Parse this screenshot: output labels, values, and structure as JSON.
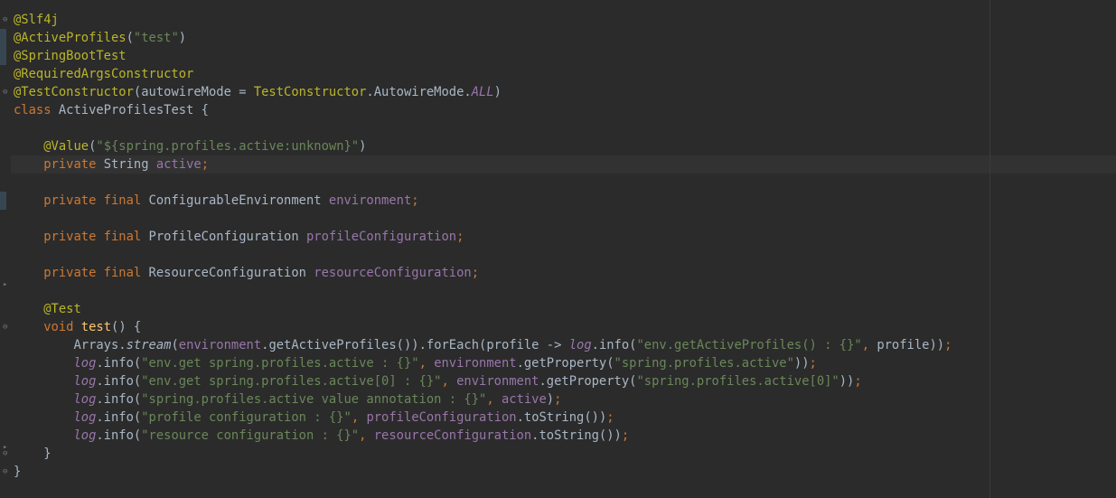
{
  "editor": {
    "lines": [
      [
        {
          "t": "@Slf4j",
          "c": "annotation"
        }
      ],
      [
        {
          "t": "@ActiveProfiles",
          "c": "annotation"
        },
        {
          "t": "(",
          "c": "plain"
        },
        {
          "t": "\"test\"",
          "c": "str"
        },
        {
          "t": ")",
          "c": "plain"
        }
      ],
      [
        {
          "t": "@SpringBootTest",
          "c": "annotation"
        }
      ],
      [
        {
          "t": "@RequiredArgsConstructor",
          "c": "annotation"
        }
      ],
      [
        {
          "t": "@TestConstructor",
          "c": "annotation"
        },
        {
          "t": "(autowireMode = ",
          "c": "plain"
        },
        {
          "t": "TestConstructor",
          "c": "annotation"
        },
        {
          "t": ".AutowireMode.",
          "c": "plain"
        },
        {
          "t": "ALL",
          "c": "static-italic"
        },
        {
          "t": ")",
          "c": "plain"
        }
      ],
      [
        {
          "t": "class ",
          "c": "kw"
        },
        {
          "t": "ActiveProfilesTest {",
          "c": "plain"
        }
      ],
      [],
      [
        {
          "t": "    ",
          "c": "plain"
        },
        {
          "t": "@Value",
          "c": "annotation"
        },
        {
          "t": "(",
          "c": "plain"
        },
        {
          "t": "\"${spring.profiles.active:unknown}\"",
          "c": "str"
        },
        {
          "t": ")",
          "c": "plain"
        }
      ],
      [
        {
          "t": "    ",
          "c": "plain"
        },
        {
          "t": "private ",
          "c": "kw"
        },
        {
          "t": "String ",
          "c": "plain"
        },
        {
          "t": "active",
          "c": "field"
        },
        {
          "t": ";",
          "c": "kw"
        }
      ],
      [],
      [
        {
          "t": "    ",
          "c": "plain"
        },
        {
          "t": "private final ",
          "c": "kw"
        },
        {
          "t": "ConfigurableEnvironment ",
          "c": "plain"
        },
        {
          "t": "environment",
          "c": "field"
        },
        {
          "t": ";",
          "c": "kw"
        }
      ],
      [],
      [
        {
          "t": "    ",
          "c": "plain"
        },
        {
          "t": "private final ",
          "c": "kw"
        },
        {
          "t": "ProfileConfiguration ",
          "c": "plain"
        },
        {
          "t": "profileConfiguration",
          "c": "field"
        },
        {
          "t": ";",
          "c": "kw"
        }
      ],
      [],
      [
        {
          "t": "    ",
          "c": "plain"
        },
        {
          "t": "private final ",
          "c": "kw"
        },
        {
          "t": "ResourceConfiguration ",
          "c": "plain"
        },
        {
          "t": "resourceConfiguration",
          "c": "field"
        },
        {
          "t": ";",
          "c": "kw"
        }
      ],
      [],
      [
        {
          "t": "    ",
          "c": "plain"
        },
        {
          "t": "@Test",
          "c": "annotation"
        }
      ],
      [
        {
          "t": "    ",
          "c": "plain"
        },
        {
          "t": "void ",
          "c": "kw"
        },
        {
          "t": "test",
          "c": "method"
        },
        {
          "t": "() {",
          "c": "plain"
        }
      ],
      [
        {
          "t": "        Arrays.",
          "c": "plain"
        },
        {
          "t": "stream",
          "c": "italic"
        },
        {
          "t": "(",
          "c": "plain"
        },
        {
          "t": "environment",
          "c": "field"
        },
        {
          "t": ".getActiveProfiles()).forEach(profile -> ",
          "c": "plain"
        },
        {
          "t": "log",
          "c": "static-italic"
        },
        {
          "t": ".info(",
          "c": "plain"
        },
        {
          "t": "\"env.getActiveProfiles() : {}\"",
          "c": "str"
        },
        {
          "t": ", ",
          "c": "kw"
        },
        {
          "t": "profile))",
          "c": "plain"
        },
        {
          "t": ";",
          "c": "kw"
        }
      ],
      [
        {
          "t": "        ",
          "c": "plain"
        },
        {
          "t": "log",
          "c": "static-italic"
        },
        {
          "t": ".info(",
          "c": "plain"
        },
        {
          "t": "\"env.get spring.profiles.active : {}\"",
          "c": "str"
        },
        {
          "t": ", ",
          "c": "kw"
        },
        {
          "t": "environment",
          "c": "field"
        },
        {
          "t": ".getProperty(",
          "c": "plain"
        },
        {
          "t": "\"spring.profiles.active\"",
          "c": "str"
        },
        {
          "t": "))",
          "c": "plain"
        },
        {
          "t": ";",
          "c": "kw"
        }
      ],
      [
        {
          "t": "        ",
          "c": "plain"
        },
        {
          "t": "log",
          "c": "static-italic"
        },
        {
          "t": ".info(",
          "c": "plain"
        },
        {
          "t": "\"env.get spring.profiles.active[0] : {}\"",
          "c": "str"
        },
        {
          "t": ", ",
          "c": "kw"
        },
        {
          "t": "environment",
          "c": "field"
        },
        {
          "t": ".getProperty(",
          "c": "plain"
        },
        {
          "t": "\"spring.profiles.active[0]\"",
          "c": "str"
        },
        {
          "t": "))",
          "c": "plain"
        },
        {
          "t": ";",
          "c": "kw"
        }
      ],
      [
        {
          "t": "        ",
          "c": "plain"
        },
        {
          "t": "log",
          "c": "static-italic"
        },
        {
          "t": ".info(",
          "c": "plain"
        },
        {
          "t": "\"spring.profiles.active value annotation : {}\"",
          "c": "str"
        },
        {
          "t": ", ",
          "c": "kw"
        },
        {
          "t": "active",
          "c": "field"
        },
        {
          "t": ")",
          "c": "plain"
        },
        {
          "t": ";",
          "c": "kw"
        }
      ],
      [
        {
          "t": "        ",
          "c": "plain"
        },
        {
          "t": "log",
          "c": "static-italic"
        },
        {
          "t": ".info(",
          "c": "plain"
        },
        {
          "t": "\"profile configuration : {}\"",
          "c": "str"
        },
        {
          "t": ", ",
          "c": "kw"
        },
        {
          "t": "profileConfiguration",
          "c": "field"
        },
        {
          "t": ".toString())",
          "c": "plain"
        },
        {
          "t": ";",
          "c": "kw"
        }
      ],
      [
        {
          "t": "        ",
          "c": "plain"
        },
        {
          "t": "log",
          "c": "static-italic"
        },
        {
          "t": ".info(",
          "c": "plain"
        },
        {
          "t": "\"resource configuration : {}\"",
          "c": "str"
        },
        {
          "t": ", ",
          "c": "kw"
        },
        {
          "t": "resourceConfiguration",
          "c": "field"
        },
        {
          "t": ".toString())",
          "c": "plain"
        },
        {
          "t": ";",
          "c": "kw"
        }
      ],
      [
        {
          "t": "    }",
          "c": "plain"
        }
      ],
      [
        {
          "t": "}",
          "c": "plain"
        }
      ]
    ]
  },
  "colors": {
    "background": "#2b2b2b",
    "caret_row": "#323232",
    "plain": "#a9b7c6",
    "keyword": "#cc7832",
    "string": "#6a8759",
    "annotation": "#bbb529",
    "field": "#9876aa",
    "method": "#ffc66d"
  }
}
